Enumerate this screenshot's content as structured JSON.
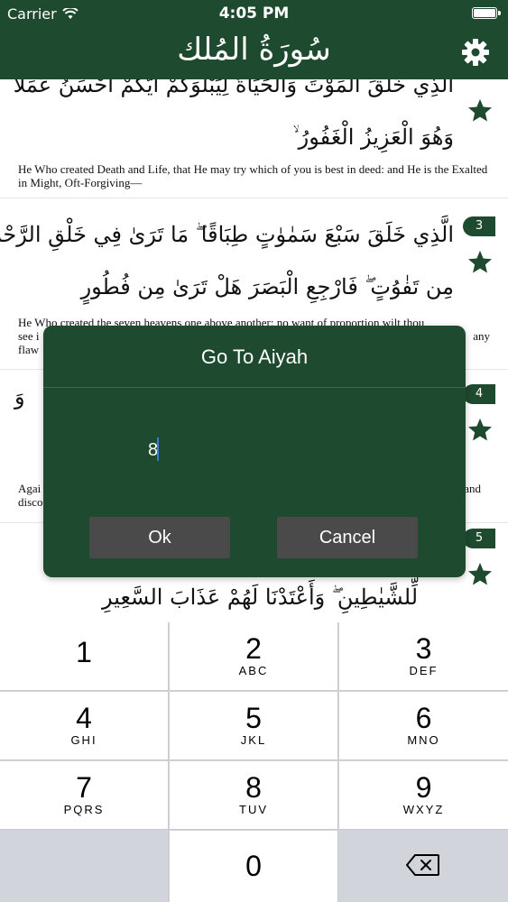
{
  "status": {
    "carrier": "Carrier",
    "time": "4:05 PM"
  },
  "header": {
    "title": "سُورَةُ المُلك"
  },
  "aiyahs": [
    {
      "arabic_top": "الَّذِي خَلَقَ الْمَوْتَ وَالْحَيَاةَ لِيَبْلُوَكُمْ أَيُّكُمْ أَحْسَنُ عَمَلًا",
      "arabic_bottom": "وَهُوَ الْعَزِيزُ الْغَفُورُ ۙ",
      "translation": "He Who created Death and Life, that He may try which of you is best in deed: and He is the Exalted in Might, Oft-Forgiving—"
    },
    {
      "number": "3",
      "arabic_top": "الَّذِي خَلَقَ سَبْعَ سَمٰوٰتٍ طِبَاقًا ۖ مَا تَرَىٰ فِي خَلْقِ الرَّحْمٰنِ",
      "arabic_bottom": "مِن تَفٰوُتٍ ۖ فَارْجِعِ الْبَصَرَ هَلْ تَرَىٰ مِن فُطُورٍ",
      "translation_line1": "He Who created the seven heavens one above another: no want of proportion wilt thou",
      "translation_line2_left": "see i",
      "translation_line2_right": "any",
      "translation_line3": "flaw"
    },
    {
      "number": "4",
      "arabic_fragment": "وَ",
      "translation_left_1": "Agai",
      "translation_left_2": "disco",
      "translation_right": "and"
    },
    {
      "number": "5",
      "arabic_bottom": "لِّلشَّيٰطِينِ ۖ وَأَعْتَدْنَا لَهُمْ عَذَابَ السَّعِيرِ"
    }
  ],
  "dialog": {
    "title": "Go To Aiyah",
    "input_value": "8",
    "ok_label": "Ok",
    "cancel_label": "Cancel"
  },
  "keypad": {
    "keys": [
      {
        "num": "1",
        "letters": ""
      },
      {
        "num": "2",
        "letters": "ABC"
      },
      {
        "num": "3",
        "letters": "DEF"
      },
      {
        "num": "4",
        "letters": "GHI"
      },
      {
        "num": "5",
        "letters": "JKL"
      },
      {
        "num": "6",
        "letters": "MNO"
      },
      {
        "num": "7",
        "letters": "PQRS"
      },
      {
        "num": "8",
        "letters": "TUV"
      },
      {
        "num": "9",
        "letters": "WXYZ"
      },
      {
        "num": "0",
        "letters": ""
      }
    ]
  },
  "colors": {
    "brand_green": "#1e4a2f",
    "button_gray": "#4a4a4a",
    "keypad_bg": "#d1d5db"
  },
  "icons": {
    "settings": "gear-icon",
    "favorite": "star-icon",
    "delete": "backspace-icon",
    "wifi": "wifi-icon"
  }
}
